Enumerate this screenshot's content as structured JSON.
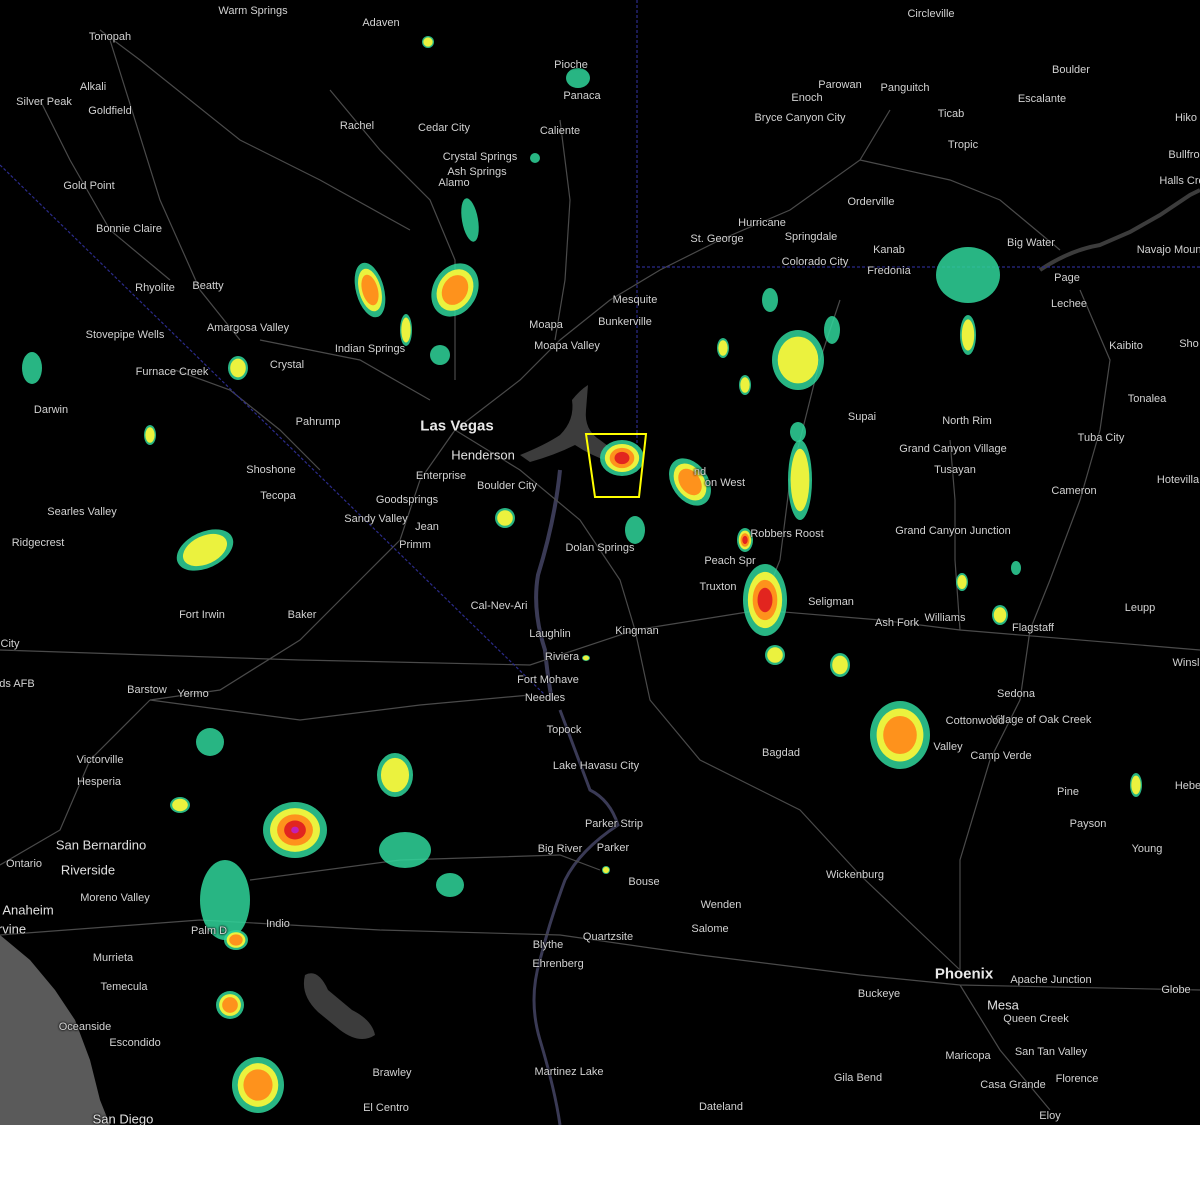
{
  "map": {
    "background": "#000000",
    "ocean_color": "#5a5a5a",
    "lake_color": "#3c3c3c",
    "road_color": "#4a4a4a",
    "state_line_color": "#2b2b8a",
    "warning_polygon_color": "#ffff00",
    "radar_colors": {
      "light": "#2fd59a",
      "moderate": "#f5f53a",
      "heavy": "#ff8c1a",
      "intense": "#e02020",
      "extreme": "#c020c0"
    }
  },
  "cities": [
    {
      "name": "Warm Springs",
      "size": "small"
    },
    {
      "name": "Adaven",
      "size": "small"
    },
    {
      "name": "Circleville",
      "size": "small"
    },
    {
      "name": "Tonopah",
      "size": "small"
    },
    {
      "name": "Pioche",
      "size": "small"
    },
    {
      "name": "Panaca",
      "size": "small"
    },
    {
      "name": "Boulder",
      "size": "small"
    },
    {
      "name": "Alkali",
      "size": "small"
    },
    {
      "name": "Parowan",
      "size": "small"
    },
    {
      "name": "Panguitch",
      "size": "small"
    },
    {
      "name": "Enoch",
      "size": "small"
    },
    {
      "name": "Escalante",
      "size": "small"
    },
    {
      "name": "Silver Peak",
      "size": "small"
    },
    {
      "name": "Goldfield",
      "size": "small"
    },
    {
      "name": "Rachel",
      "size": "small"
    },
    {
      "name": "Cedar City",
      "size": "small"
    },
    {
      "name": "Bryce Canyon City",
      "size": "small"
    },
    {
      "name": "Ticab",
      "size": "small"
    },
    {
      "name": "Hiko",
      "size": "small"
    },
    {
      "name": "Caliente",
      "size": "small"
    },
    {
      "name": "Tropic",
      "size": "small"
    },
    {
      "name": "Bullfro",
      "size": "small"
    },
    {
      "name": "Crystal Springs",
      "size": "small"
    },
    {
      "name": "Ash Springs",
      "size": "small"
    },
    {
      "name": "Halls Cro",
      "size": "small"
    },
    {
      "name": "Alamo",
      "size": "small"
    },
    {
      "name": "Gold Point",
      "size": "small"
    },
    {
      "name": "Orderville",
      "size": "small"
    },
    {
      "name": "Bonnie Claire",
      "size": "small"
    },
    {
      "name": "Hurricane",
      "size": "small"
    },
    {
      "name": "St. George",
      "size": "small"
    },
    {
      "name": "Springdale",
      "size": "small"
    },
    {
      "name": "Kanab",
      "size": "small"
    },
    {
      "name": "Big Water",
      "size": "small"
    },
    {
      "name": "Navajo Mountain",
      "size": "small"
    },
    {
      "name": "Colorado City",
      "size": "small"
    },
    {
      "name": "Fredonia",
      "size": "small"
    },
    {
      "name": "Page",
      "size": "small"
    },
    {
      "name": "Rhyolite",
      "size": "small"
    },
    {
      "name": "Beatty",
      "size": "small"
    },
    {
      "name": "Mesquite",
      "size": "small"
    },
    {
      "name": "Lechee",
      "size": "small"
    },
    {
      "name": "Amargosa Valley",
      "size": "small"
    },
    {
      "name": "Bunkerville",
      "size": "small"
    },
    {
      "name": "Stovepipe Wells",
      "size": "small"
    },
    {
      "name": "Moapa",
      "size": "small"
    },
    {
      "name": "Kaibito",
      "size": "small"
    },
    {
      "name": "Sho",
      "size": "small"
    },
    {
      "name": "Indian Springs",
      "size": "small"
    },
    {
      "name": "Moapa Valley",
      "size": "small"
    },
    {
      "name": "Crystal",
      "size": "small"
    },
    {
      "name": "Furnace Creek",
      "size": "small"
    },
    {
      "name": "Darwin",
      "size": "small"
    },
    {
      "name": "Supai",
      "size": "small"
    },
    {
      "name": "Tonalea",
      "size": "small"
    },
    {
      "name": "Pahrump",
      "size": "small"
    },
    {
      "name": "North Rim",
      "size": "small"
    },
    {
      "name": "Las Vegas",
      "size": "major"
    },
    {
      "name": "Tuba City",
      "size": "small"
    },
    {
      "name": "Grand Canyon Village",
      "size": "small"
    },
    {
      "name": "Henderson",
      "size": "mid"
    },
    {
      "name": "Shoshone",
      "size": "small"
    },
    {
      "name": "Tusayan",
      "size": "small"
    },
    {
      "name": "Hotevilla",
      "size": "small"
    },
    {
      "name": "Enterprise",
      "size": "small"
    },
    {
      "name": "nd",
      "size": "small"
    },
    {
      "name": "Boulder City",
      "size": "small"
    },
    {
      "name": "on West",
      "size": "small"
    },
    {
      "name": "Cameron",
      "size": "small"
    },
    {
      "name": "Tecopa",
      "size": "small"
    },
    {
      "name": "Goodsprings",
      "size": "small"
    },
    {
      "name": "Searles Valley",
      "size": "small"
    },
    {
      "name": "Sandy Valley",
      "size": "small"
    },
    {
      "name": "Jean",
      "size": "small"
    },
    {
      "name": "Grand Canyon Junction",
      "size": "small"
    },
    {
      "name": "Robbers Roost",
      "size": "small"
    },
    {
      "name": "Ridgecrest",
      "size": "small"
    },
    {
      "name": "Primm",
      "size": "small"
    },
    {
      "name": "Dolan Springs",
      "size": "small"
    },
    {
      "name": "Peach Spr",
      "size": "small"
    },
    {
      "name": "Truxton",
      "size": "small"
    },
    {
      "name": "Cal-Nev-Ari",
      "size": "small"
    },
    {
      "name": "Seligman",
      "size": "small"
    },
    {
      "name": "Leupp",
      "size": "small"
    },
    {
      "name": "Fort Irwin",
      "size": "small"
    },
    {
      "name": "Baker",
      "size": "small"
    },
    {
      "name": "Ash Fork",
      "size": "small"
    },
    {
      "name": "Williams",
      "size": "small"
    },
    {
      "name": "Flagstaff",
      "size": "small"
    },
    {
      "name": "City",
      "size": "small"
    },
    {
      "name": "Laughlin",
      "size": "small"
    },
    {
      "name": "Kingman",
      "size": "small"
    },
    {
      "name": "Riviera",
      "size": "small"
    },
    {
      "name": "Winsl",
      "size": "small"
    },
    {
      "name": "Fort Mohave",
      "size": "small"
    },
    {
      "name": "ds AFB",
      "size": "small"
    },
    {
      "name": "Barstow",
      "size": "small"
    },
    {
      "name": "Yermo",
      "size": "small"
    },
    {
      "name": "Needles",
      "size": "small"
    },
    {
      "name": "Sedona",
      "size": "small"
    },
    {
      "name": "Village of Oak Creek",
      "size": "small"
    },
    {
      "name": "Topock",
      "size": "small"
    },
    {
      "name": "Cottonwood",
      "size": "small"
    },
    {
      "name": "Valley",
      "size": "small"
    },
    {
      "name": "Bagdad",
      "size": "small"
    },
    {
      "name": "Camp Verde",
      "size": "small"
    },
    {
      "name": "Victorville",
      "size": "small"
    },
    {
      "name": "Lake Havasu City",
      "size": "small"
    },
    {
      "name": "Hesperia",
      "size": "small"
    },
    {
      "name": "Hebe",
      "size": "small"
    },
    {
      "name": "Pine",
      "size": "small"
    },
    {
      "name": "Payson",
      "size": "small"
    },
    {
      "name": "Parker Strip",
      "size": "small"
    },
    {
      "name": "San Bernardino",
      "size": "mid"
    },
    {
      "name": "Big River",
      "size": "small"
    },
    {
      "name": "Parker",
      "size": "small"
    },
    {
      "name": "Young",
      "size": "small"
    },
    {
      "name": "Ontario",
      "size": "small"
    },
    {
      "name": "Riverside",
      "size": "mid"
    },
    {
      "name": "Wickenburg",
      "size": "small"
    },
    {
      "name": "Bouse",
      "size": "small"
    },
    {
      "name": "Moreno Valley",
      "size": "small"
    },
    {
      "name": "Anaheim",
      "size": "mid"
    },
    {
      "name": "Wenden",
      "size": "small"
    },
    {
      "name": "rvine",
      "size": "mid"
    },
    {
      "name": "Indio",
      "size": "small"
    },
    {
      "name": "Palm D",
      "size": "small"
    },
    {
      "name": "Salome",
      "size": "small"
    },
    {
      "name": "Quartzsite",
      "size": "small"
    },
    {
      "name": "Blythe",
      "size": "small"
    },
    {
      "name": "Ehrenberg",
      "size": "small"
    },
    {
      "name": "Murrieta",
      "size": "small"
    },
    {
      "name": "Phoenix",
      "size": "major"
    },
    {
      "name": "Apache Junction",
      "size": "small"
    },
    {
      "name": "Temecula",
      "size": "small"
    },
    {
      "name": "Buckeye",
      "size": "small"
    },
    {
      "name": "Mesa",
      "size": "mid"
    },
    {
      "name": "Globe",
      "size": "small"
    },
    {
      "name": "Queen Creek",
      "size": "small"
    },
    {
      "name": "Oceanside",
      "size": "small"
    },
    {
      "name": "Escondido",
      "size": "small"
    },
    {
      "name": "San Tan Valley",
      "size": "small"
    },
    {
      "name": "Maricopa",
      "size": "small"
    },
    {
      "name": "Martinez Lake",
      "size": "small"
    },
    {
      "name": "Brawley",
      "size": "small"
    },
    {
      "name": "Gila Bend",
      "size": "small"
    },
    {
      "name": "Florence",
      "size": "small"
    },
    {
      "name": "Casa Grande",
      "size": "small"
    },
    {
      "name": "El Centro",
      "size": "small"
    },
    {
      "name": "Dateland",
      "size": "small"
    },
    {
      "name": "San Diego",
      "size": "mid"
    },
    {
      "name": "Eloy",
      "size": "small"
    }
  ]
}
